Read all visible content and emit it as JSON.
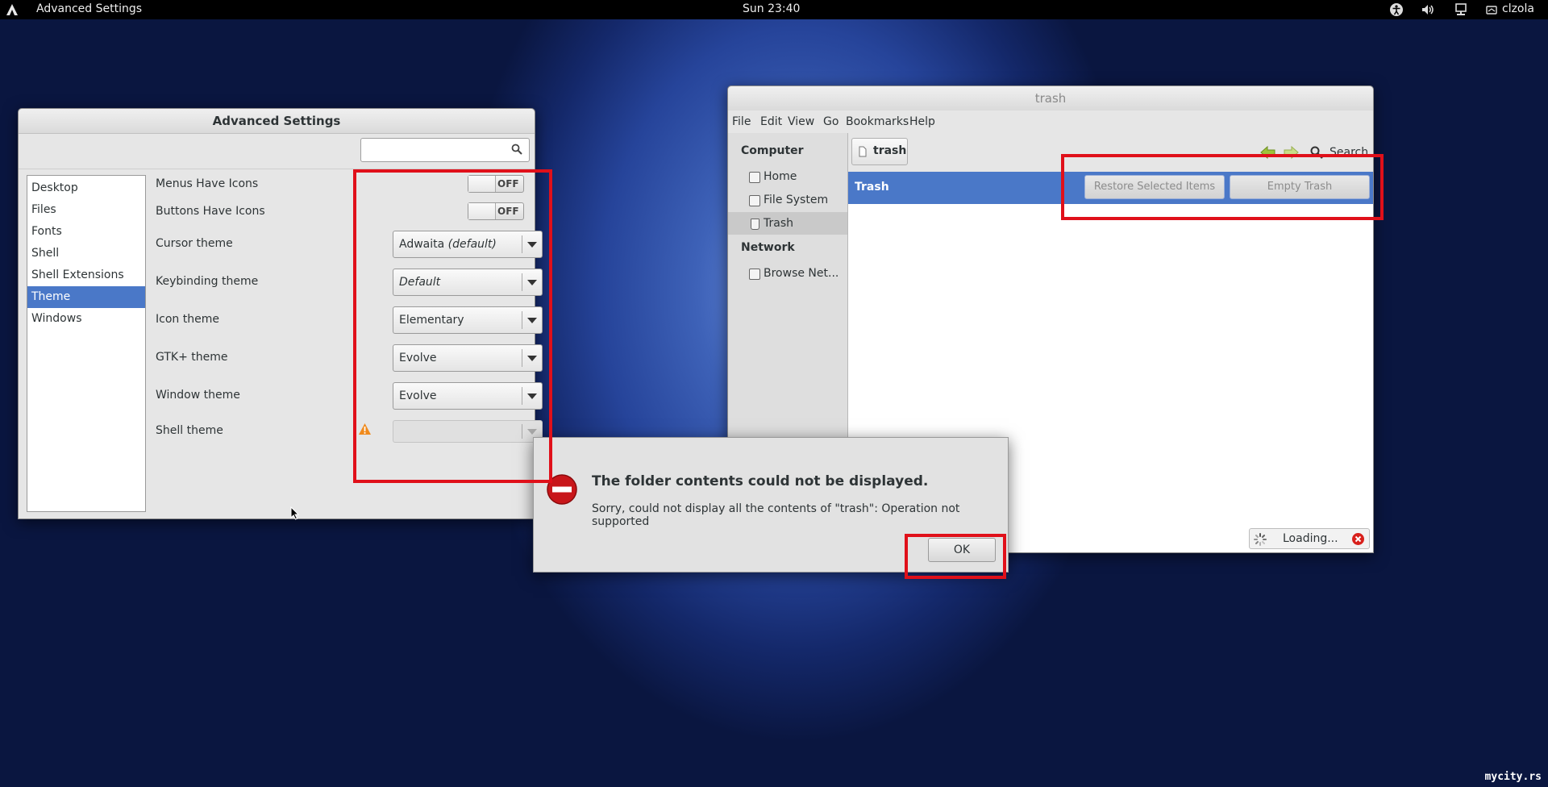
{
  "topbar": {
    "activities_icon": "activities-icon",
    "app_name": "Advanced Settings",
    "clock": "Sun 23:40",
    "user": "clzola",
    "icons": [
      "accessibility-icon",
      "volume-icon",
      "network-icon",
      "user-icon"
    ]
  },
  "advanced_settings": {
    "title": "Advanced Settings",
    "search": {
      "value": "",
      "placeholder": ""
    },
    "sidebar": [
      {
        "label": "Desktop",
        "selected": false
      },
      {
        "label": "Files",
        "selected": false
      },
      {
        "label": "Fonts",
        "selected": false
      },
      {
        "label": "Shell",
        "selected": false
      },
      {
        "label": "Shell Extensions",
        "selected": false
      },
      {
        "label": "Theme",
        "selected": true
      },
      {
        "label": "Windows",
        "selected": false
      }
    ],
    "settings": {
      "menus_have_icons": {
        "label": "Menus Have Icons",
        "state": "OFF"
      },
      "buttons_have_icons": {
        "label": "Buttons Have Icons",
        "state": "OFF"
      },
      "cursor_theme": {
        "label": "Cursor theme",
        "value": "Adwaita",
        "value_suffix": "(default)"
      },
      "keybinding_theme": {
        "label": "Keybinding theme",
        "value": "Default"
      },
      "icon_theme": {
        "label": "Icon theme",
        "value": "Elementary"
      },
      "gtk_theme": {
        "label": "GTK+ theme",
        "value": "Evolve"
      },
      "window_theme": {
        "label": "Window theme",
        "value": "Evolve"
      },
      "shell_theme": {
        "label": "Shell theme",
        "value": "",
        "warning_icon": "warning-icon"
      }
    }
  },
  "file_manager": {
    "title": "trash",
    "menu": [
      "File",
      "Edit",
      "View",
      "Go",
      "Bookmarks",
      "Help"
    ],
    "places": {
      "computer_header": "Computer",
      "computer_items": [
        {
          "label": "Home",
          "icon": "home-icon"
        },
        {
          "label": "File System",
          "icon": "drive-icon"
        },
        {
          "label": "Trash",
          "icon": "trash-icon"
        }
      ],
      "network_header": "Network",
      "network_items": [
        {
          "label": "Browse Net...",
          "icon": "network-folder-icon"
        }
      ]
    },
    "path_button": "trash",
    "search_label": "Search",
    "trash_bar": {
      "label": "Trash",
      "restore_button": "Restore Selected Items",
      "empty_button": "Empty Trash"
    },
    "loading_text": "Loading..."
  },
  "dialog": {
    "title": "The folder contents could not be displayed.",
    "message": "Sorry, could not display all the contents of \"trash\": Operation not supported",
    "ok_button": "OK",
    "icon": "error-icon"
  },
  "watermark": "mycity.rs"
}
